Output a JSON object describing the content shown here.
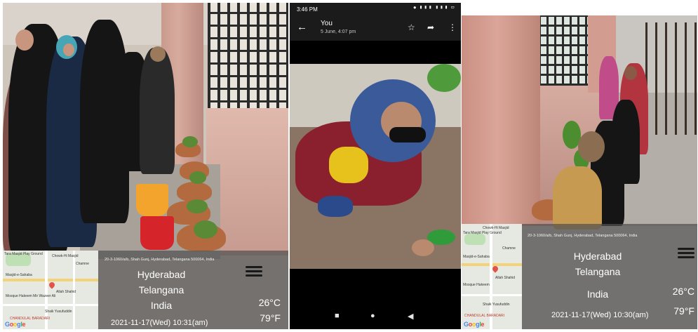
{
  "panel1": {
    "map": {
      "labels": [
        "Tara Masjid Play Ground",
        "Chowk-Hi Masjid",
        "Chamne",
        "Masjid-e-Sahaba",
        "Allah Shahid",
        "Mosque Hakeem Mir Wazeer Ali",
        "Shaik Yusufuddin",
        "CHANDULAL BARADARI"
      ],
      "logo": "Google"
    },
    "stamp": {
      "address": "20-3-1060/a/b, Shah Gunj, Hyderabad, Telangana 500064, India",
      "city": "Hyderabad",
      "state": "Telangana",
      "country": "India",
      "temp_c": "26°C",
      "temp_f": "79°F",
      "datetime": "2021-11-17(Wed)   10:31(am)"
    }
  },
  "panel2": {
    "status_bar": {
      "time": "3:46 PM",
      "icons": "⏺ ▮▮▮ ▮▮▮ ▭"
    },
    "app_bar": {
      "title": "You",
      "subtitle": "5 June, 4:07 pm",
      "back": "←",
      "star": "☆",
      "share": "➦",
      "more": "⋮"
    },
    "nav": {
      "recents": "■",
      "home": "●",
      "back": "◀"
    }
  },
  "panel3": {
    "map": {
      "labels": [
        "Chowk-Hi Masjid",
        "Tara Masjid Play Ground",
        "Chamne",
        "Masjid-e-Sahaba",
        "Allah Shahid",
        "Mosque Hakeem",
        "Shaik Yusufuddin",
        "CHANDULAL BARADARI"
      ],
      "logo": "Google"
    },
    "stamp": {
      "address": "20-3-1060/a/b, Shah Gunj, Hyderabad, Telangana 500064, India",
      "city": "Hyderabad",
      "state": "Telangana",
      "country": "India",
      "temp_c": "26°C",
      "temp_f": "79°F",
      "datetime": "2021-11-17(Wed)   10:30(am)"
    }
  },
  "colors": {
    "stamp_overlay": "#505050",
    "phone_bar": "#1b1b1b",
    "pillar": "#d8ab9f",
    "abaya": "#151515"
  }
}
